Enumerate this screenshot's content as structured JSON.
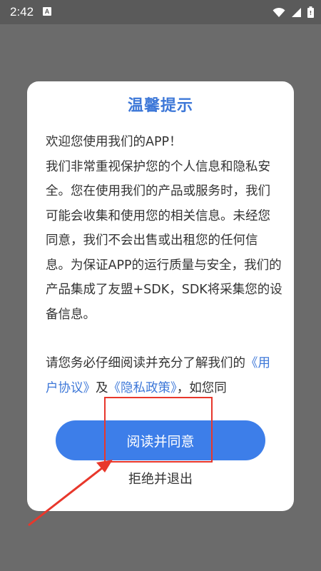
{
  "status_bar": {
    "time": "2:42",
    "notification_icon_text": "A",
    "icons": [
      "wifi-icon",
      "signal-icon",
      "battery-icon"
    ]
  },
  "dialog": {
    "title": "温馨提示",
    "paragraph1": "欢迎您使用我们的APP！\n我们非常重视保护您的个人信息和隐私安全。您在使用我们的产品或服务时，我们可能会收集和使用您的相关信息。未经您同意，我们不会出售或出租您的任何信息。为保证APP的运行质量与安全，我们的产品集成了友盟+SDK，SDK将采集您的设备信息。",
    "paragraph2_prefix": "请您务必仔细阅读并充分了解我们的",
    "user_agreement_link": "《用户协议》",
    "and_text": "及",
    "privacy_policy_link": "《隐私政策》",
    "paragraph2_suffix": "，如您同",
    "agree_button": "阅读并同意",
    "refuse_button": "拒绝并退出"
  },
  "colors": {
    "title": "#3e78d8",
    "button": "#3d7ee9",
    "annotation": "#e8372b"
  }
}
